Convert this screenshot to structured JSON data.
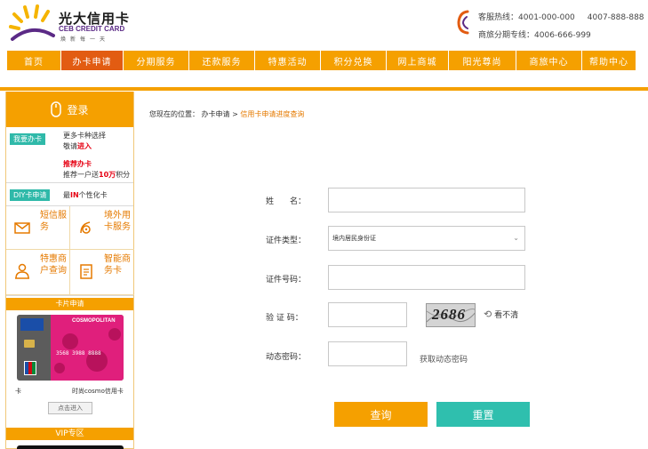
{
  "header": {
    "logo_title": "光大信用卡",
    "logo_sub": "CEB CREDIT CARD",
    "logo_slogan": "焕新每一天",
    "hotline_label": "客服热线：",
    "hotline_1": "4001-000-000",
    "hotline_2": "4007-888-888",
    "installment_label": "商旅分期专线：",
    "installment_phone": "4006-666-999"
  },
  "nav": {
    "items": [
      {
        "label": "首页"
      },
      {
        "label": "办卡申请"
      },
      {
        "label": "分期服务"
      },
      {
        "label": "还款服务"
      },
      {
        "label": "特惠活动"
      },
      {
        "label": "积分兑换"
      },
      {
        "label": "网上商城"
      },
      {
        "label": "阳光尊尚"
      },
      {
        "label": "商旅中心"
      },
      {
        "label": "帮助中心"
      }
    ],
    "active_index": 1,
    "accent_color": "#f5a000",
    "active_color": "#e25c12"
  },
  "sidebar": {
    "login": "登录",
    "apply_tag": "我要办卡",
    "apply_line1": "更多卡种选择",
    "apply_line2_a": "敬请",
    "apply_line2_b": "进入",
    "recommend_title": "推荐办卡",
    "recommend_line_a": "推荐一户送",
    "recommend_line_b": "10万",
    "recommend_line_c": "积分",
    "diy_tag": "DIY卡申请",
    "diy_text_a": "最",
    "diy_text_b": "IN",
    "diy_text_c": "个性化卡",
    "services": [
      {
        "label": "短信服务",
        "icon": "sms-icon"
      },
      {
        "label": "境外用卡服务",
        "icon": "overseas-icon"
      },
      {
        "label": "特惠商户查询",
        "icon": "merchant-icon"
      },
      {
        "label": "智能商务卡",
        "icon": "business-card-icon"
      }
    ],
    "card_section": "卡片申请",
    "card_brand": "COSMOPOLITAN",
    "card_number": "3568 3988 8888",
    "card_caption_left": "卡",
    "card_caption_right": "时尚cosmo信用卡",
    "card_button": "点击进入",
    "vip_section": "VIP专区"
  },
  "breadcrumb": {
    "prefix": "您现在的位置：",
    "level1": "办卡申请",
    "separator": " > ",
    "current": "信用卡申请进度查询"
  },
  "form": {
    "name_label": "姓　　名：",
    "name_value": "",
    "id_type_label": "证件类型：",
    "id_type_value": "境内居民身份证",
    "id_number_label": "证件号码：",
    "id_number_value": "",
    "captcha_label": "验 证 码：",
    "captcha_value": "",
    "captcha_image_text": "2686",
    "refresh_text": "看不清",
    "dynamic_label": "动态密码：",
    "dynamic_value": "",
    "get_dynamic": "获取动态密码",
    "query_button": "查询",
    "reset_button": "重置"
  }
}
